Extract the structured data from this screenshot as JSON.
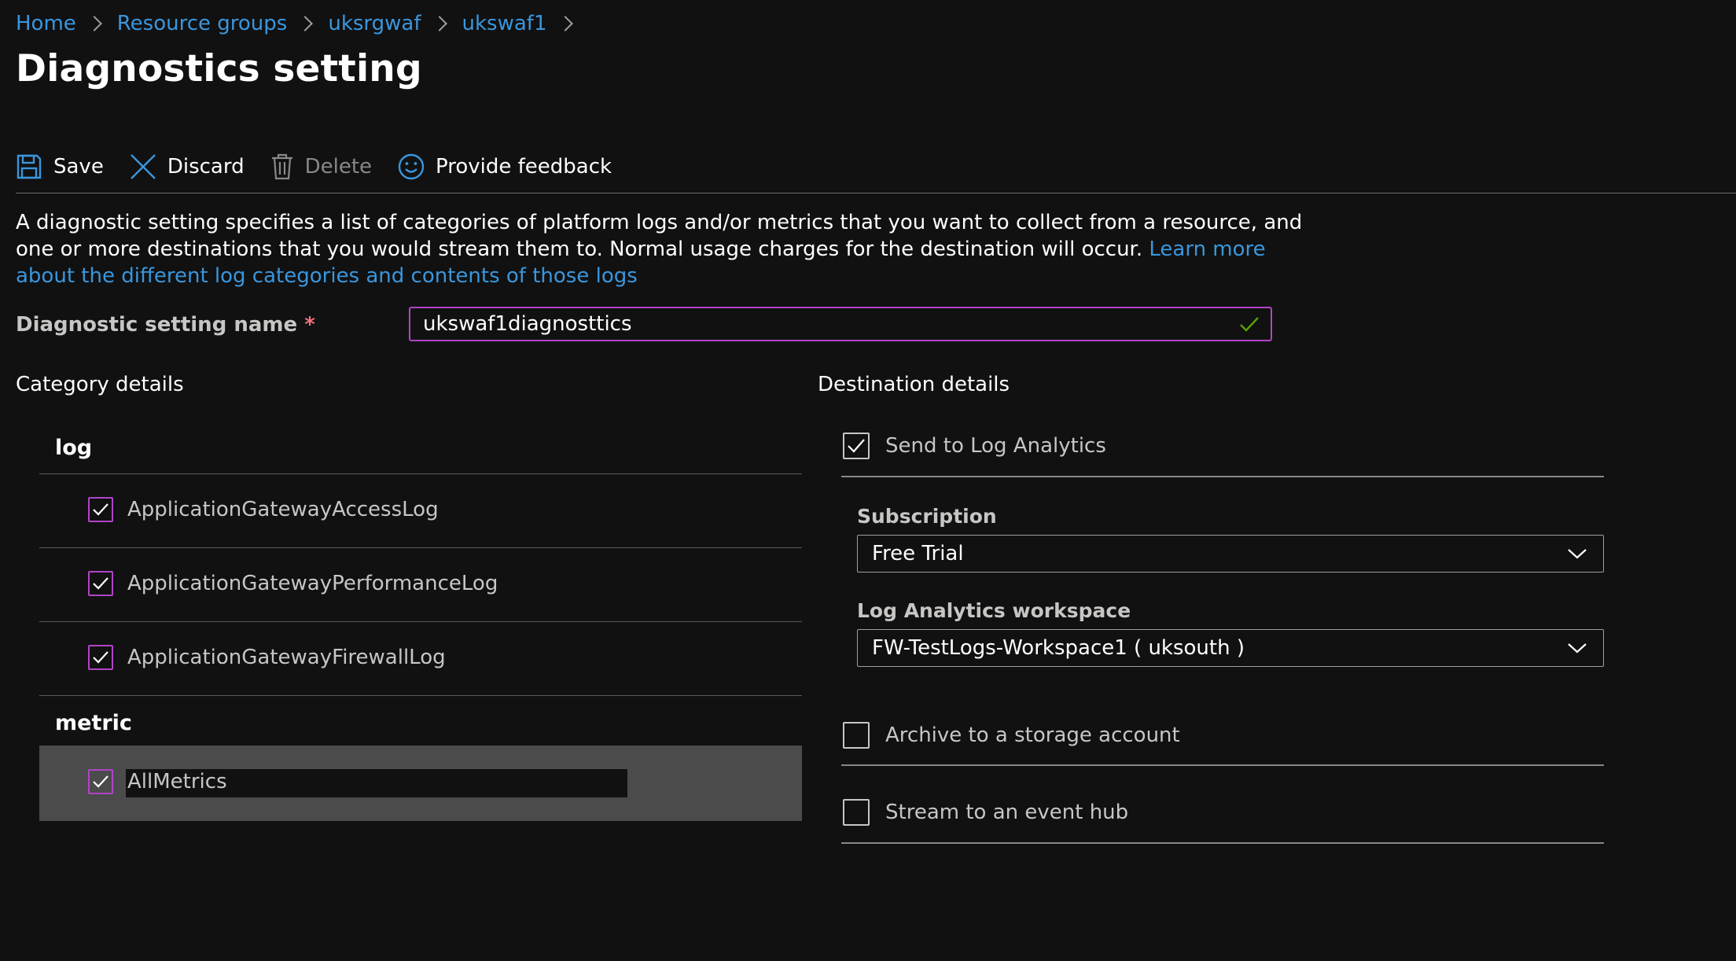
{
  "breadcrumb": [
    "Home",
    "Resource groups",
    "uksrgwaf",
    "ukswaf1"
  ],
  "page_title": "Diagnostics setting",
  "toolbar": {
    "save": "Save",
    "discard": "Discard",
    "delete": "Delete",
    "feedback": "Provide feedback"
  },
  "description": {
    "text": "A diagnostic setting specifies a list of categories of platform logs and/or metrics that you want to collect from a resource, and one or more destinations that you would stream them to. Normal usage charges for the destination will occur. ",
    "link": "Learn more about the different log categories and contents of those logs"
  },
  "name_field": {
    "label": "Diagnostic setting name",
    "required_marker": "*",
    "value": "ukswaf1diagnosttics"
  },
  "category": {
    "heading": "Category details",
    "log_heading": "log",
    "logs": [
      {
        "label": "ApplicationGatewayAccessLog",
        "checked": true
      },
      {
        "label": "ApplicationGatewayPerformanceLog",
        "checked": true
      },
      {
        "label": "ApplicationGatewayFirewallLog",
        "checked": true
      }
    ],
    "metric_heading": "metric",
    "metrics": [
      {
        "label": "AllMetrics",
        "checked": true
      }
    ]
  },
  "destination": {
    "heading": "Destination details",
    "log_analytics": {
      "label": "Send to Log Analytics",
      "checked": true
    },
    "subscription": {
      "label": "Subscription",
      "value": "Free Trial"
    },
    "workspace": {
      "label": "Log Analytics workspace",
      "value": "FW-TestLogs-Workspace1 ( uksouth )"
    },
    "storage": {
      "label": "Archive to a storage account",
      "checked": false
    },
    "event_hub": {
      "label": "Stream to an event hub",
      "checked": false
    }
  },
  "colors": {
    "background": "#111111",
    "link": "#3a96dd",
    "checkbox_accent": "#b144c7",
    "valid_check": "#57a300",
    "required": "#f1707b"
  }
}
